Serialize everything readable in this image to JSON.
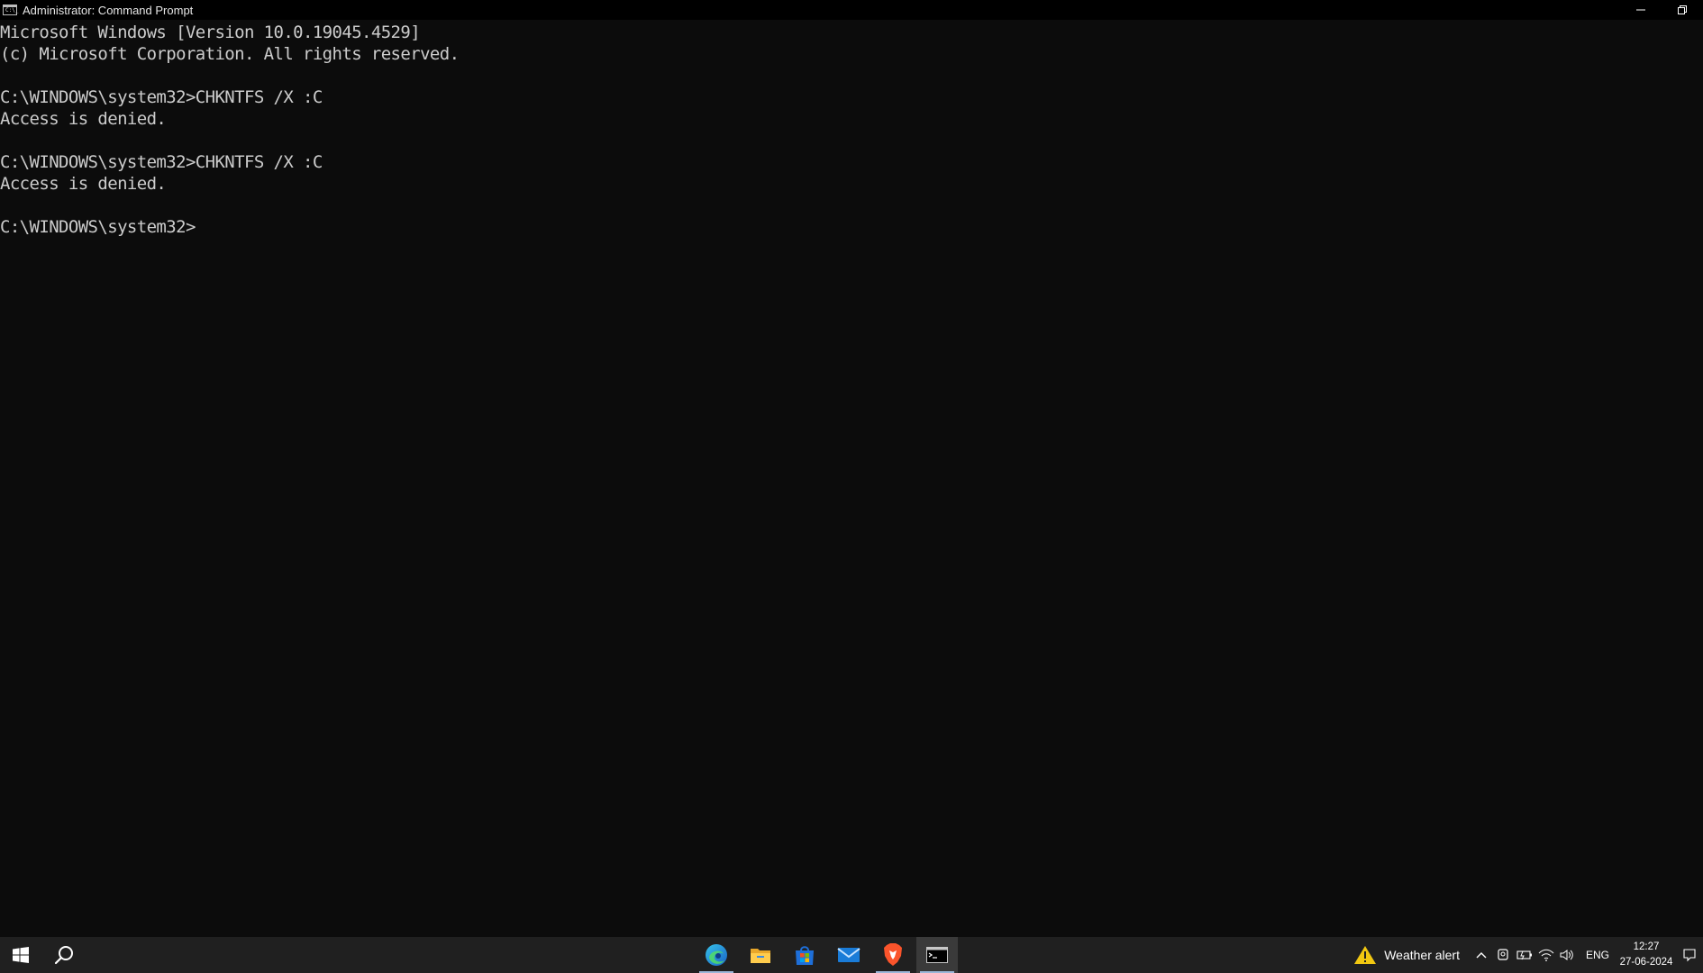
{
  "window": {
    "title": "Administrator: Command Prompt",
    "icon": "cmd-icon",
    "icon_text": "C:\\_"
  },
  "console": {
    "lines": [
      "Microsoft Windows [Version 10.0.19045.4529]",
      "(c) Microsoft Corporation. All rights reserved.",
      "",
      "C:\\WINDOWS\\system32>CHKNTFS /X :C",
      "Access is denied.",
      "",
      "C:\\WINDOWS\\system32>CHKNTFS /X :C",
      "Access is denied.",
      "",
      "C:\\WINDOWS\\system32>"
    ],
    "text_color": "#cccccc",
    "background": "#0c0c0c"
  },
  "taskbar": {
    "apps": [
      {
        "name": "edge-icon",
        "active": false,
        "running": true
      },
      {
        "name": "file-explorer-icon",
        "active": false,
        "running": false
      },
      {
        "name": "microsoft-store-icon",
        "active": false,
        "running": false
      },
      {
        "name": "mail-icon",
        "active": false,
        "running": false
      },
      {
        "name": "brave-icon",
        "active": false,
        "running": true
      },
      {
        "name": "cmd-icon",
        "active": true,
        "running": true
      }
    ],
    "weather_alert": "Weather alert",
    "language": "ENG",
    "time": "12:27",
    "date": "27-06-2024",
    "accent": "#9ab6d8"
  }
}
